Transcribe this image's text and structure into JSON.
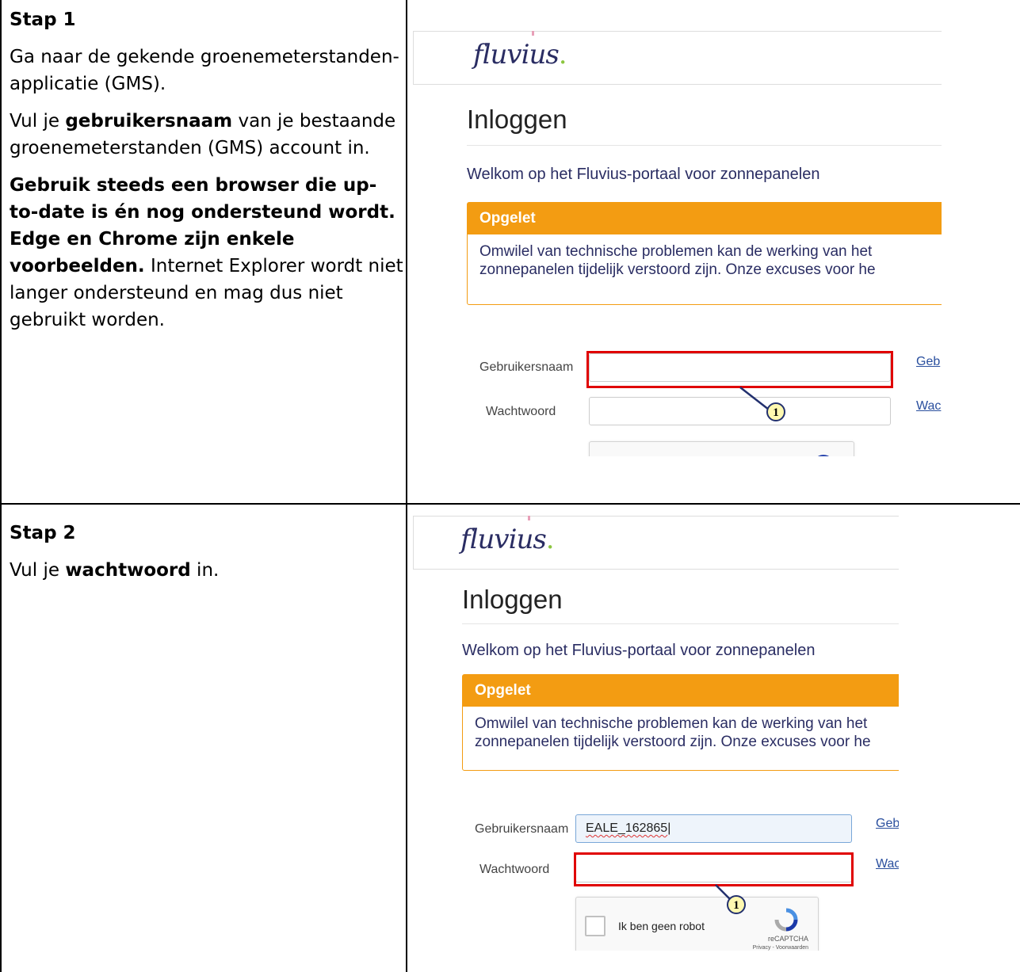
{
  "step1": {
    "title": "Stap 1",
    "p1": "Ga naar de gekende groenemeterstanden-applicatie (GMS).",
    "p2_pre": "Vul je ",
    "p2_bold": "gebruikersnaam",
    "p2_post": " van je bestaande groenemeterstanden (GMS) account in.",
    "p3_bold": "Gebruik steeds een browser die up-to-date is én nog ondersteund wordt. Edge en Chrome zijn enkele voorbeelden.",
    "p3_post": " Internet Explorer wordt niet langer ondersteund en mag dus niet gebruikt worden."
  },
  "step2": {
    "title": "Stap 2",
    "p1_pre": "Vul je ",
    "p1_bold": "wachtwoord",
    "p1_post": " in."
  },
  "portal": {
    "logo": "fluvius",
    "logo_dot": ".",
    "heading": "Inloggen",
    "welcome": "Welkom op het Fluvius-portaal voor zonnepanelen",
    "warning_title": "Opgelet",
    "warning_line1": "Omwilel van technische problemen kan de werking van het",
    "warning_line2": "zonnepanelen tijdelijk verstoord zijn. Onze excuses voor he",
    "username_label": "Gebruikersnaam",
    "password_label": "Wachtwoord",
    "username_link": "Geb",
    "password_link": "Wac",
    "username_value_step2": "EALE_162865",
    "callout_number": "1",
    "captcha_label": "Ik ben geen robot",
    "captcha_brand": "reCAPTCHA",
    "captcha_privacy": "Privacy - Voorwaarden"
  },
  "colors": {
    "brand_navy": "#2a2d63",
    "brand_green": "#8cc63f",
    "warning_orange": "#f39c12",
    "highlight_red": "#e00000"
  }
}
